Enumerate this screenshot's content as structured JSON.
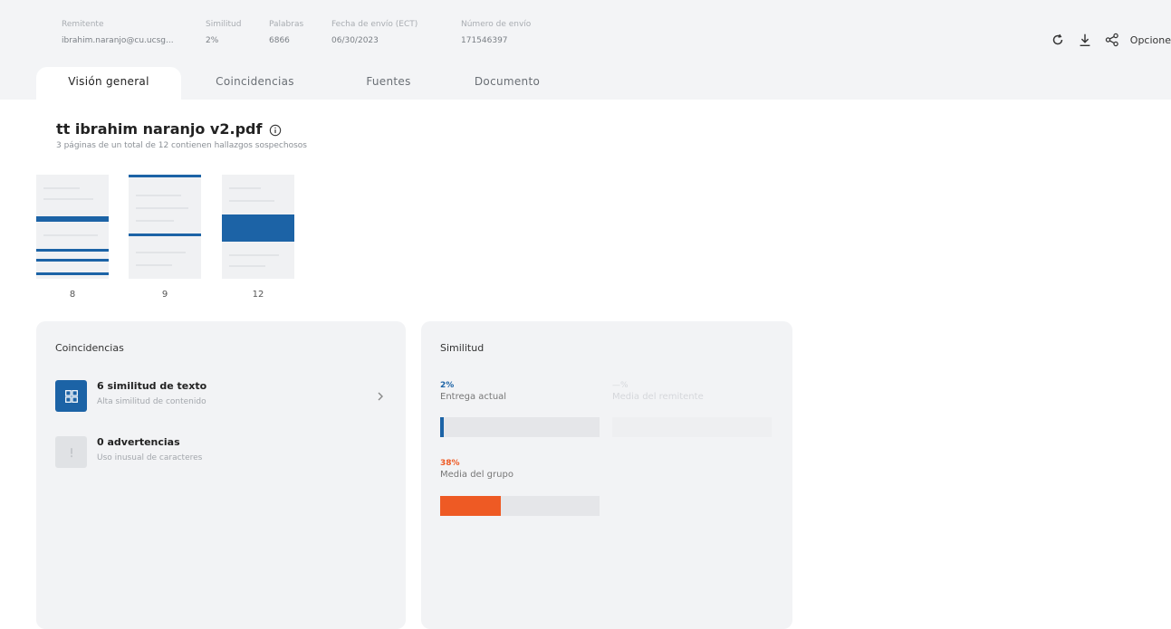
{
  "header": {
    "meta": [
      {
        "label": "Remitente",
        "value": "ibrahim.naranjo@cu.ucsg..."
      },
      {
        "label": "Similitud",
        "value": "2%"
      },
      {
        "label": "Palabras",
        "value": "6866"
      },
      {
        "label": "Fecha de envío (ECT)",
        "value": "06/30/2023"
      },
      {
        "label": "Número de envío",
        "value": "171546397"
      }
    ],
    "options_label": "Opcione"
  },
  "tabs": [
    {
      "label": "Visión general",
      "active": true
    },
    {
      "label": "Coincidencias",
      "active": false
    },
    {
      "label": "Fuentes",
      "active": false
    },
    {
      "label": "Documento",
      "active": false
    }
  ],
  "document": {
    "title": "tt ibrahim naranjo v2.pdf",
    "subtitle": "3 páginas de un total de 12 contienen hallazgos sospechosos"
  },
  "pages": [
    {
      "number": "8"
    },
    {
      "number": "9"
    },
    {
      "number": "12"
    }
  ],
  "matches_card": {
    "title": "Coincidencias",
    "items": [
      {
        "title": "6 similitud de texto",
        "subtitle": "Alta similitud de contenido",
        "icon": "text-match-icon"
      },
      {
        "title": "0 advertencias",
        "subtitle": "Uso inusual de caracteres",
        "icon": "warning-icon"
      }
    ]
  },
  "similarity_card": {
    "title": "Similitud",
    "current": {
      "percent": "2%",
      "label": "Entrega actual",
      "value": 0.02
    },
    "sender_avg": {
      "percent": "—%",
      "label": "Media del remitente"
    },
    "group_avg": {
      "percent": "38%",
      "label": "Media del grupo",
      "value": 0.38
    }
  },
  "colors": {
    "accent_blue": "#1c63a6",
    "accent_orange": "#ee5a24",
    "panel_bg": "#f2f3f5",
    "header_bg": "#f3f4f6"
  }
}
